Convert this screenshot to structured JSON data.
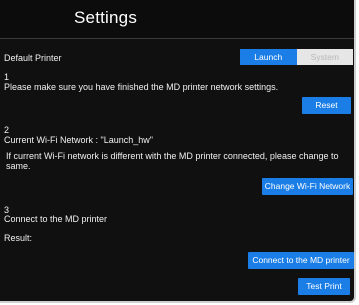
{
  "header": {
    "title": "Settings"
  },
  "default_printer": {
    "label": "Default Printer",
    "options": [
      "Launch",
      "System"
    ],
    "selected": "Launch"
  },
  "step1": {
    "number": "1",
    "text": "Please make sure you have finished the MD printer network settings.",
    "button": "Reset"
  },
  "step2": {
    "number": "2",
    "network_text": "Current Wi-Fi Network : \"Launch_hw\"",
    "warning": "If current Wi-Fi network is different with the MD printer connected, please change to same.",
    "button": "Change Wi-Fi Network"
  },
  "step3": {
    "number": "3",
    "text": "Connect to the MD printer",
    "result_label": "Result:",
    "connect_button": "Connect to the MD printer",
    "test_button": "Test Print"
  },
  "colors": {
    "background": "#101010",
    "accent": "#1a7ee6",
    "segment_inactive": "#e6e6e6"
  }
}
